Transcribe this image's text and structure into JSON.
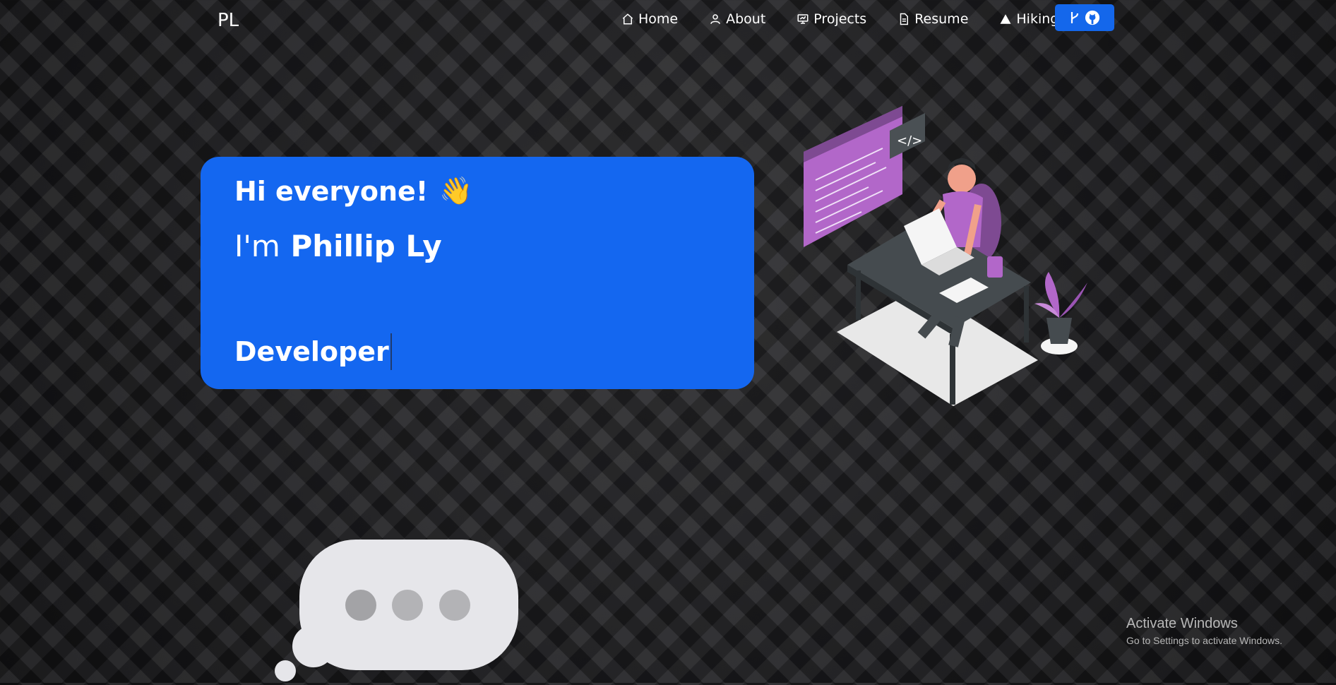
{
  "brand": "PL",
  "nav": {
    "home": "Home",
    "about": "About",
    "projects": "Projects",
    "resume": "Resume",
    "hiking": "Hiking"
  },
  "hero": {
    "greeting": "Hi everyone!",
    "greeting_emoji": "👋",
    "name_prefix": "I'm",
    "name": "Phillip Ly",
    "role": "Developer"
  },
  "icons": {
    "home": "home-icon",
    "about": "user-icon",
    "projects": "monitor-icon",
    "resume": "document-icon",
    "hiking": "mountain-icon",
    "fork": "fork-icon",
    "github": "github-icon"
  },
  "watermark": {
    "title": "Activate Windows",
    "subtitle": "Go to Settings to activate Windows."
  },
  "colors": {
    "accent": "#1467f0",
    "background": "#1e1e20",
    "illustration_purple": "#b267c9"
  }
}
